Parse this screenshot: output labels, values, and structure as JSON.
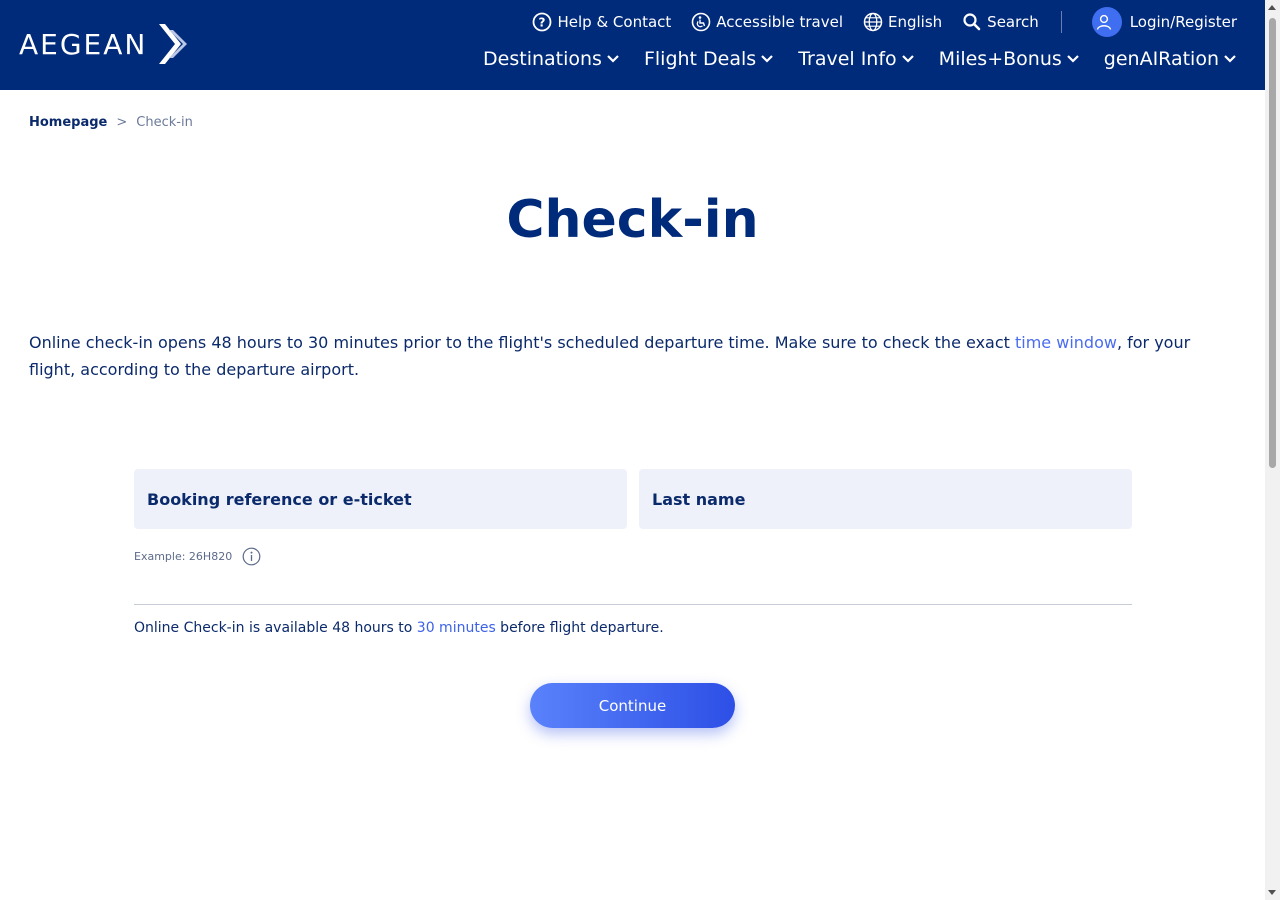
{
  "header": {
    "logo_text": "AEGEAN",
    "utility": {
      "help": "Help & Contact",
      "accessible": "Accessible travel",
      "language": "English",
      "search": "Search",
      "login": "Login/Register"
    },
    "nav": [
      {
        "label": "Destinations"
      },
      {
        "label": "Flight Deals"
      },
      {
        "label": "Travel Info"
      },
      {
        "label": "Miles+Bonus"
      },
      {
        "label": "genAIRation"
      }
    ]
  },
  "breadcrumb": {
    "home": "Homepage",
    "separator": ">",
    "current": "Check-in"
  },
  "page": {
    "title": "Check-in",
    "intro_before": "Online check-in opens 48 hours to 30 minutes prior to the flight's scheduled departure time. Make sure to check the exact ",
    "intro_link": "time window",
    "intro_after": ", for your flight, according to the departure airport."
  },
  "form": {
    "booking_label": "Booking reference or e-ticket",
    "lastname_label": "Last name",
    "hint": "Example: 26H820",
    "availability_before": "Online Check-in is available 48 hours to ",
    "availability_link": "30 minutes",
    "availability_after": " before flight departure.",
    "continue_label": "Continue"
  },
  "colors": {
    "header_bg": "#002a7a",
    "accent": "#3c62e8",
    "field_bg": "#eef1fa"
  }
}
